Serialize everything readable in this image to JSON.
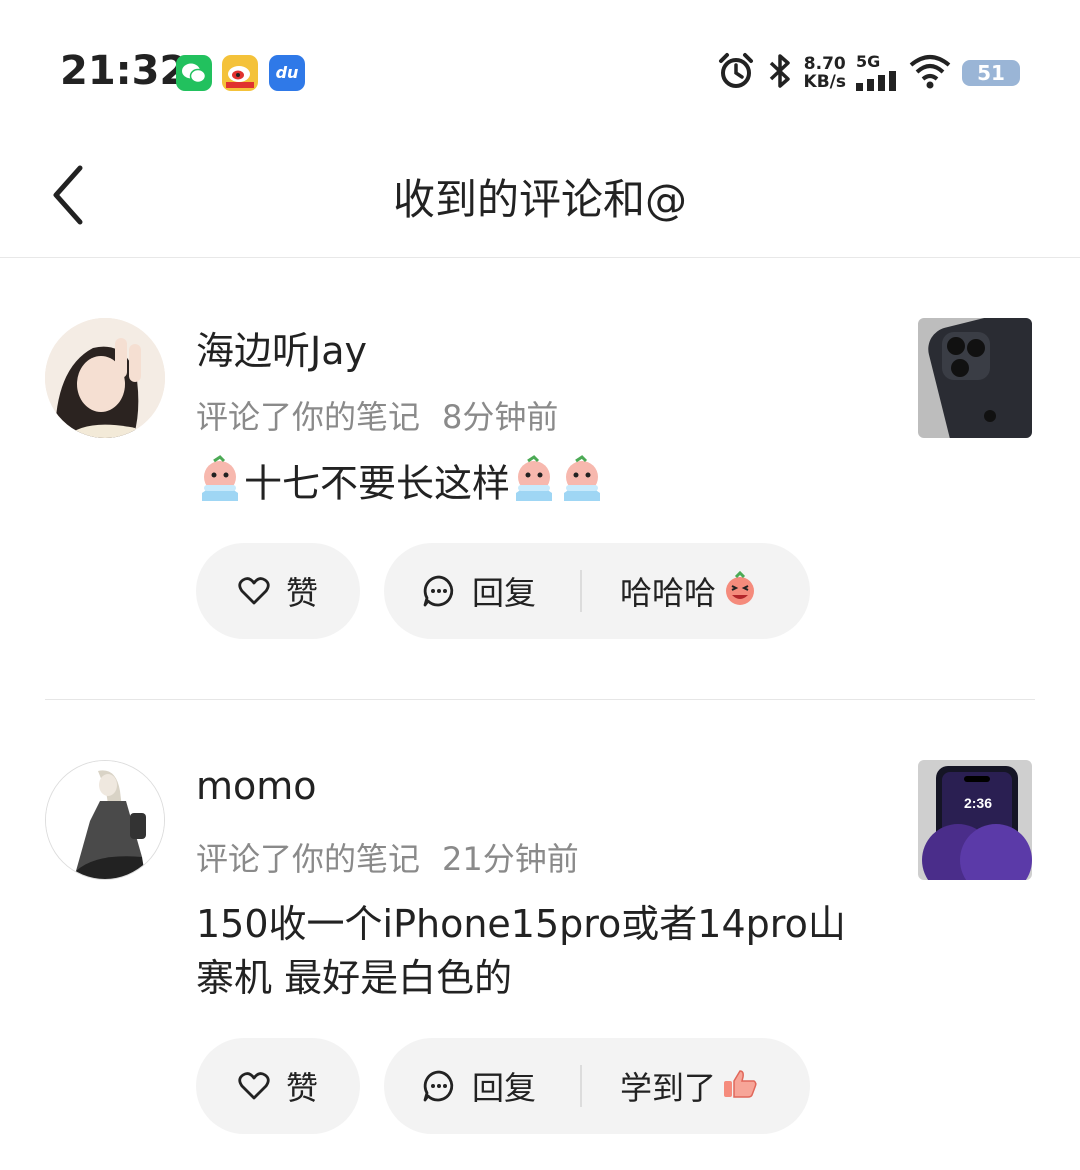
{
  "status_bar": {
    "time": "21:32",
    "apps": [
      "wechat-icon",
      "weibo-icon",
      "du-icon"
    ],
    "du_label": "du",
    "speed_value": "8.70",
    "speed_unit": "KB/s",
    "network": "5G",
    "battery": "51"
  },
  "header": {
    "title": "收到的评论和@",
    "back_icon": "chevron-left-icon"
  },
  "comments": [
    {
      "username": "海边听Jay",
      "action": "评论了你的笔记",
      "time_ago": "8分钟前",
      "text": "十七不要长这样",
      "like_label": "赞",
      "reply_label": "回复",
      "quick_reply": "哈哈哈"
    },
    {
      "username": "momo",
      "action": "评论了你的笔记",
      "time_ago": "21分钟前",
      "text_line1": "150收一个iPhone15pro或者14pro山",
      "text_line2": "寨机 最好是白色的",
      "thumb_time": "2:36",
      "like_label": "赞",
      "reply_label": "回复",
      "quick_reply": "学到了"
    }
  ],
  "colors": {
    "pill_bg": "#f3f3f3",
    "meta_text": "#8a8a8a",
    "wechat": "#22c15e",
    "du": "#2f79e8"
  }
}
